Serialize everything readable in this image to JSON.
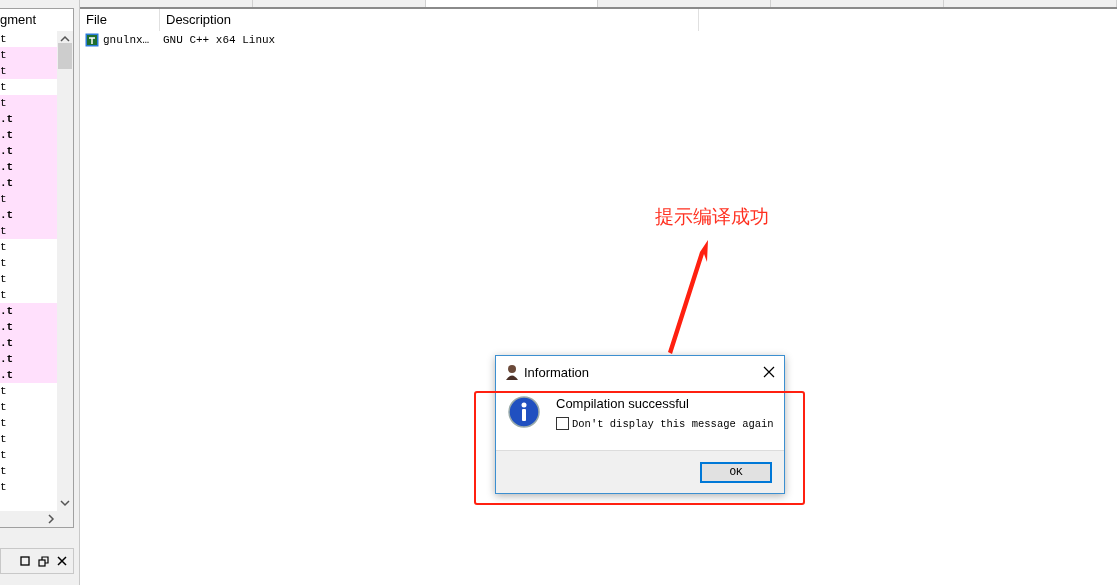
{
  "left_panel": {
    "header": "gment",
    "rows": [
      {
        "text": "t",
        "highlighted": false,
        "bold": false
      },
      {
        "text": "t",
        "highlighted": true,
        "bold": false
      },
      {
        "text": "t",
        "highlighted": true,
        "bold": false
      },
      {
        "text": "t",
        "highlighted": false,
        "bold": false
      },
      {
        "text": "t",
        "highlighted": true,
        "bold": false
      },
      {
        "text": ".t",
        "highlighted": true,
        "bold": true
      },
      {
        "text": ".t",
        "highlighted": true,
        "bold": true
      },
      {
        "text": ".t",
        "highlighted": true,
        "bold": true
      },
      {
        "text": ".t",
        "highlighted": true,
        "bold": true
      },
      {
        "text": ".t",
        "highlighted": true,
        "bold": true
      },
      {
        "text": "t",
        "highlighted": true,
        "bold": false
      },
      {
        "text": ".t",
        "highlighted": true,
        "bold": true
      },
      {
        "text": "t",
        "highlighted": true,
        "bold": false
      },
      {
        "text": "t",
        "highlighted": false,
        "bold": false
      },
      {
        "text": "t",
        "highlighted": false,
        "bold": false
      },
      {
        "text": "t",
        "highlighted": false,
        "bold": false
      },
      {
        "text": "t",
        "highlighted": false,
        "bold": false
      },
      {
        "text": ".t",
        "highlighted": true,
        "bold": true
      },
      {
        "text": ".t",
        "highlighted": true,
        "bold": true
      },
      {
        "text": ".t",
        "highlighted": true,
        "bold": true
      },
      {
        "text": ".t",
        "highlighted": true,
        "bold": true
      },
      {
        "text": ".t",
        "highlighted": true,
        "bold": true
      },
      {
        "text": "t",
        "highlighted": false,
        "bold": false
      },
      {
        "text": "t",
        "highlighted": false,
        "bold": false
      },
      {
        "text": "t",
        "highlighted": false,
        "bold": false
      },
      {
        "text": "t",
        "highlighted": false,
        "bold": false
      },
      {
        "text": "t",
        "highlighted": false,
        "bold": false
      },
      {
        "text": "t",
        "highlighted": false,
        "bold": false
      },
      {
        "text": "t",
        "highlighted": false,
        "bold": false
      }
    ]
  },
  "tabs": [
    {
      "selected": false
    },
    {
      "selected": false
    },
    {
      "selected": true
    },
    {
      "selected": false
    },
    {
      "selected": false
    },
    {
      "selected": false
    }
  ],
  "table": {
    "columns": [
      "File",
      "Description"
    ],
    "rows": [
      {
        "file": "gnulnx…",
        "description": "GNU C++ x64 Linux"
      }
    ]
  },
  "annotation": {
    "text": "提示编译成功"
  },
  "dialog": {
    "title": "Information",
    "message": "Compilation successful",
    "checkbox": {
      "label": "Don't display this message again",
      "checked": false
    },
    "button": "OK"
  }
}
